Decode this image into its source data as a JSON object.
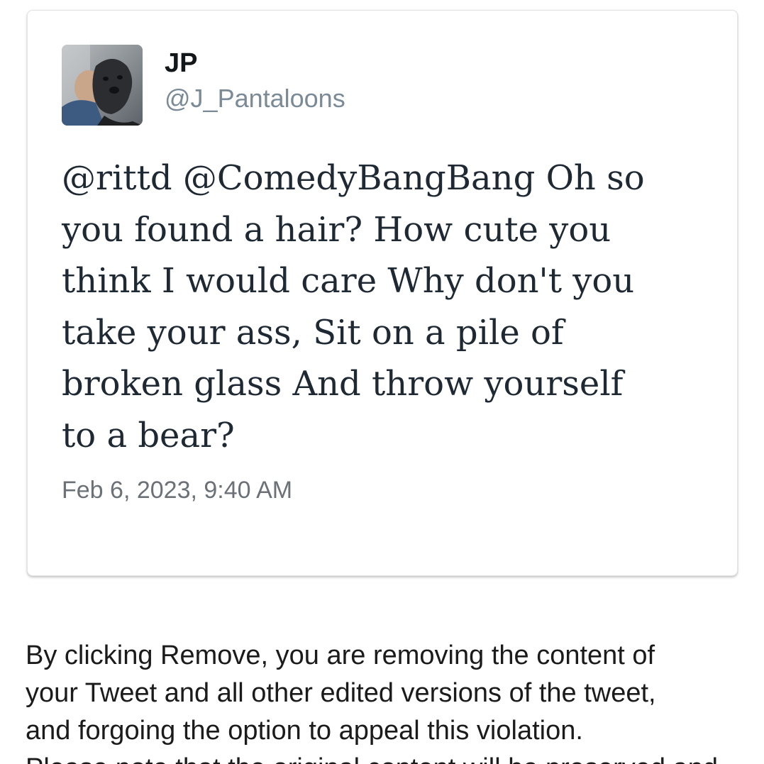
{
  "tweet": {
    "avatar_icon": "user-avatar-photo-with-dog",
    "display_name": "JP",
    "handle": "@J_Pantaloons",
    "text": "@rittd @ComedyBangBang Oh so\nyou found a hair? How cute you\nthink I would care Why don't you\ntake your ass, Sit on a pile of\nbroken glass And throw yourself\nto a bear?",
    "timestamp": "Feb 6, 2023, 9:40 AM"
  },
  "notice": {
    "text": "By clicking Remove, you are removing the content of\nyour Tweet and all other edited versions of the tweet,\nand forgoing the option to appeal this violation.\nPlease note that the original content will be preserved and"
  },
  "colors": {
    "handle": "#7a8a96",
    "body_text": "#1f2933",
    "timestamp": "#6b7177",
    "card_border": "#e4e4e4"
  }
}
